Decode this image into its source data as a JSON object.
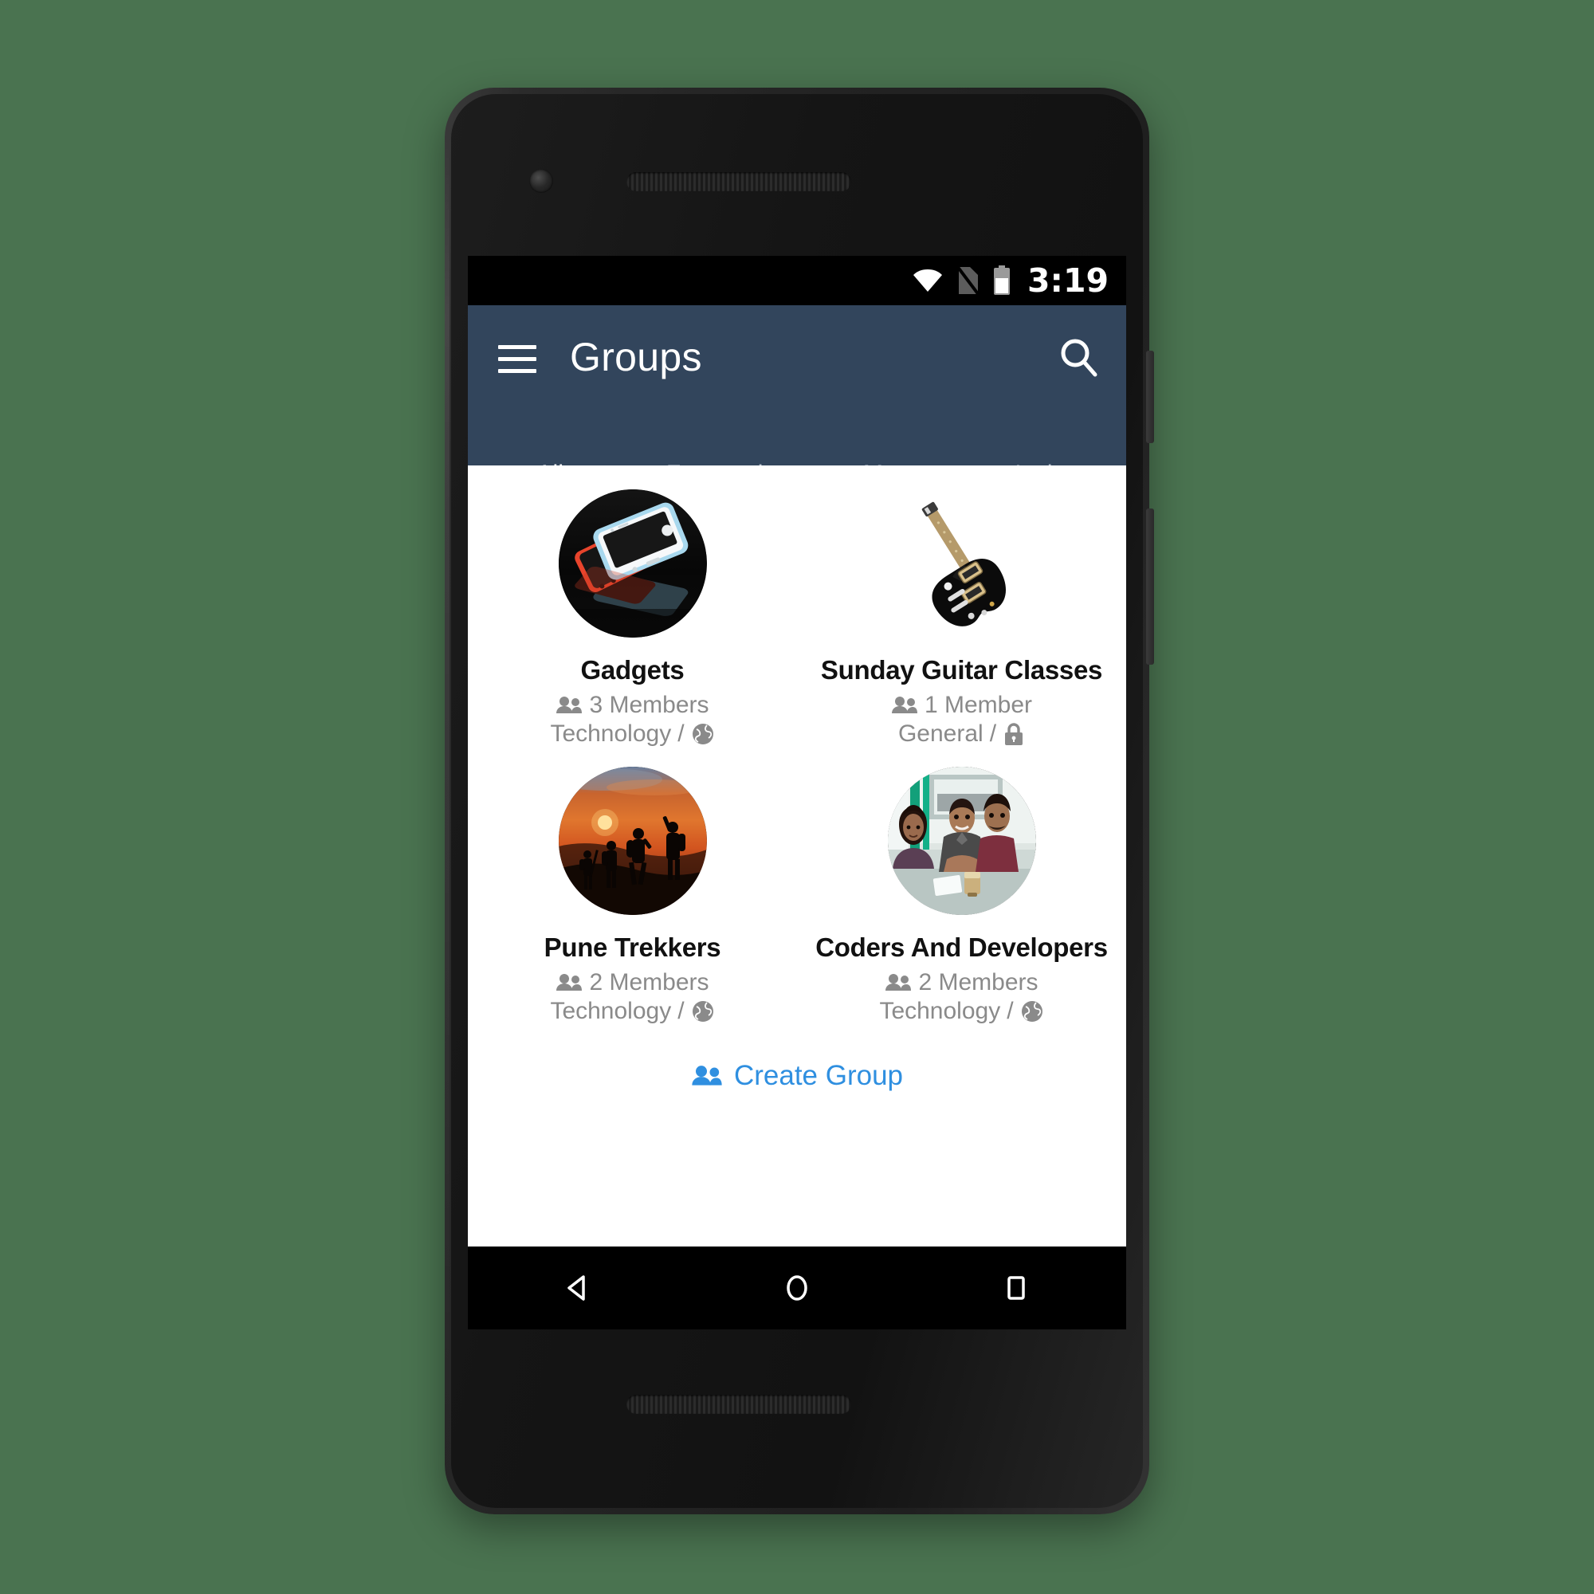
{
  "theme": {
    "page_background": "#4a7350",
    "app_bar_color": "#32455c",
    "accent_link_color": "#2f8fe0",
    "screen_background": "#ffffff",
    "status_bar_color": "#000000"
  },
  "status_bar": {
    "clock": "3:19",
    "icons": [
      "wifi-icon",
      "no-sim-icon",
      "battery-icon"
    ]
  },
  "app_bar": {
    "menu_icon": "hamburger-menu-icon",
    "title": "Groups",
    "search_icon": "search-icon"
  },
  "tabs": [
    {
      "label": "All",
      "active": true
    },
    {
      "label": "Featured",
      "active": false
    },
    {
      "label": "My",
      "active": false
    },
    {
      "label": "Invite",
      "active": false
    }
  ],
  "groups": [
    {
      "name": "Gadgets",
      "members": "3 Members",
      "category": "Technology",
      "privacy": "public",
      "privacy_icon": "globe-icon",
      "avatar": "smartphones-photo"
    },
    {
      "name": "Sunday Guitar Classes",
      "members": "1 Member",
      "category": "General",
      "privacy": "private",
      "privacy_icon": "lock-icon",
      "avatar": "electric-guitar-photo"
    },
    {
      "name": "Pune Trekkers",
      "members": "2 Members",
      "category": "Technology",
      "privacy": "public",
      "privacy_icon": "globe-icon",
      "avatar": "sunset-trekkers-photo"
    },
    {
      "name": "Coders And Developers",
      "members": "2 Members",
      "category": "Technology",
      "privacy": "public",
      "privacy_icon": "globe-icon",
      "avatar": "team-office-photo"
    }
  ],
  "separator": "/",
  "create_group": {
    "label": "Create Group",
    "icon": "people-icon"
  },
  "nav_bar": {
    "back": "back-triangle-icon",
    "home": "home-circle-icon",
    "recents": "recents-square-icon"
  }
}
